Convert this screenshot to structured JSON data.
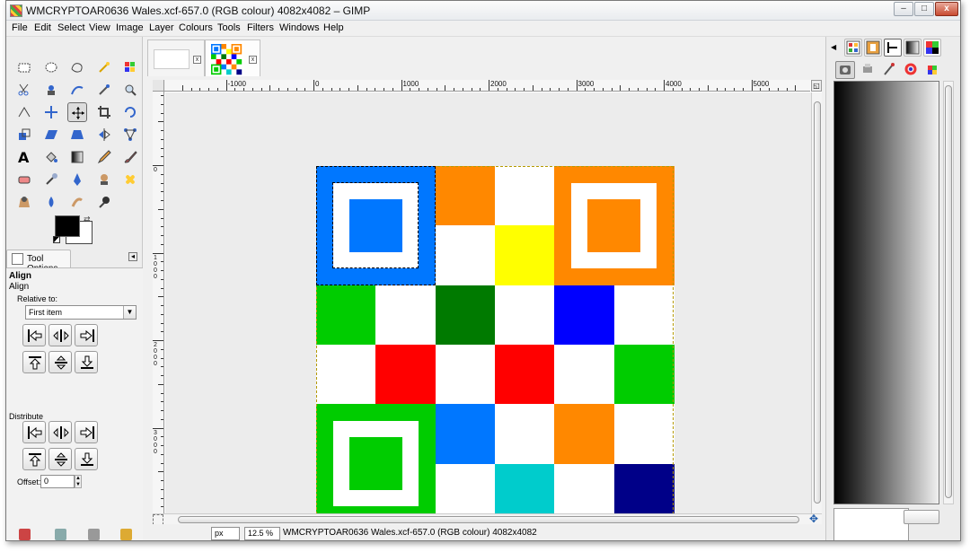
{
  "window": {
    "title": "WMCRYPTOAR0636 Wales.xcf-657.0 (RGB colour) 4082x4082 – GIMP",
    "controls": {
      "minimize": "–",
      "maximize": "□",
      "close": "x"
    }
  },
  "menubar": [
    "File",
    "Edit",
    "Select",
    "View",
    "Image",
    "Layer",
    "Colours",
    "Tools",
    "Filters",
    "Windows",
    "Help"
  ],
  "toolbox": {
    "tools": [
      "rect-select",
      "ellipse-select",
      "free-select",
      "fuzzy-select",
      "color-select",
      "scissors-select",
      "foreground-select",
      "paths",
      "color-picker",
      "zoom",
      "measure",
      "move",
      "align",
      "crop",
      "rotate",
      "scale",
      "shear",
      "perspective",
      "flip",
      "cage-transform",
      "text",
      "bucket-fill",
      "blend",
      "pencil",
      "paintbrush",
      "eraser",
      "airbrush",
      "ink",
      "clone",
      "heal",
      "perspective-clone",
      "blur-sharpen",
      "smudge",
      "dodge-burn"
    ],
    "active_tool": "align",
    "fg_color": "#000000",
    "bg_color": "#ffffff"
  },
  "tool_options": {
    "tab_label": "Tool Options",
    "title": "Align",
    "subtitle": "Align",
    "relative_label": "Relative to:",
    "relative_value": "First item",
    "distribute_label": "Distribute",
    "offset_label": "Offset:",
    "offset_value": "0"
  },
  "image_tabs": [
    {
      "name": "blank-image",
      "close": "x"
    },
    {
      "name": "qr-image",
      "close": "x"
    }
  ],
  "rulers": {
    "horizontal": [
      "-1000",
      "0",
      "1000",
      "2000",
      "3000",
      "4000",
      "5000"
    ],
    "vertical": [
      "0",
      "1000",
      "2000",
      "3000",
      "4000"
    ]
  },
  "image": {
    "grid": [
      [
        "#0077ff",
        "#0077ff",
        "#ff8800",
        "#ffffff",
        "#ff8800",
        "#ff8800"
      ],
      [
        "#0077ff",
        "#0077ff",
        "#ffffff",
        "#ffff00",
        "#ff8800",
        "#ff8800"
      ],
      [
        "#00cc00",
        "#ffffff",
        "#007a00",
        "#ffffff",
        "#0000ff",
        "#ffffff"
      ],
      [
        "#ffffff",
        "#ff0000",
        "#ffffff",
        "#ff0000",
        "#ffffff",
        "#00cc00"
      ],
      [
        "#00cc00",
        "#00cc00",
        "#0077ff",
        "#ffffff",
        "#ff8800",
        "#ffffff"
      ],
      [
        "#00cc00",
        "#00cc00",
        "#ffffff",
        "#00cccc",
        "#ffffff",
        "#000088"
      ]
    ],
    "finder_colors": [
      "#0077ff",
      "#ff8800",
      "#00cc00"
    ]
  },
  "statusbar": {
    "unit": "px",
    "zoom": "12.5 %",
    "text": "WMCRYPTOAR0636 Wales.xcf-657.0 (RGB colour) 4082x4082"
  },
  "dock": {
    "top_tabs": [
      "pattern",
      "brushes-palette",
      "fonts",
      "gradients",
      "palettes"
    ],
    "active_top_tab": "gradients",
    "inner_tabs": [
      "tool-presets",
      "printer",
      "paint-dynamics",
      "colours",
      "channels"
    ]
  }
}
